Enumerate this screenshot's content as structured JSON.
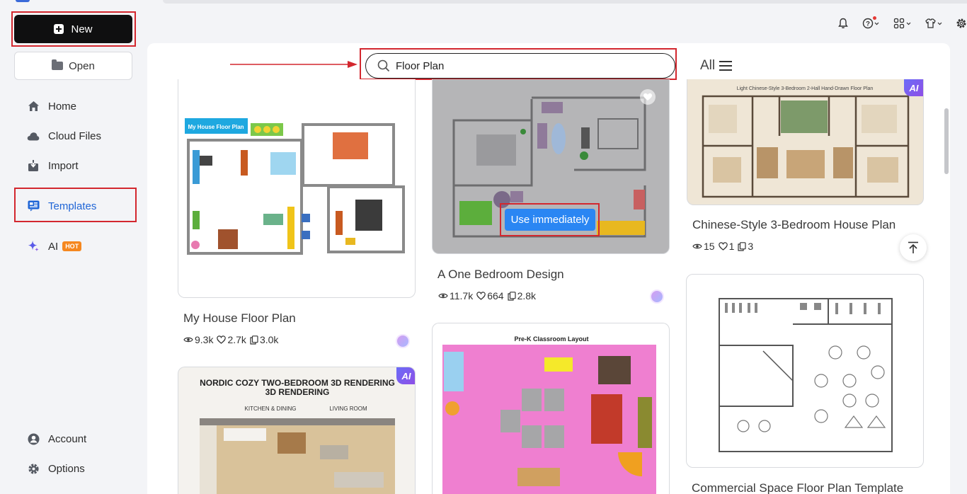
{
  "sidebar": {
    "new_label": "New",
    "open_label": "Open",
    "nav": [
      {
        "label": "Home",
        "icon": "home-icon"
      },
      {
        "label": "Cloud Files",
        "icon": "cloud-icon"
      },
      {
        "label": "Import",
        "icon": "import-icon"
      },
      {
        "label": "Templates",
        "icon": "templates-icon"
      },
      {
        "label": "AI",
        "icon": "ai-sparkle-icon",
        "badge": "HOT"
      }
    ],
    "bottom": [
      {
        "label": "Account",
        "icon": "account-icon"
      },
      {
        "label": "Options",
        "icon": "gear-icon"
      }
    ]
  },
  "header": {
    "icons": [
      "bell-icon",
      "help-icon",
      "apps-icon",
      "skin-icon",
      "settings-icon"
    ]
  },
  "search": {
    "value": "Floor Plan"
  },
  "filter": {
    "label": "All"
  },
  "cards": [
    {
      "title": "My House Floor Plan",
      "views": "9.3k",
      "likes": "2.7k",
      "copies": "3.0k",
      "thumb_label": "My House Floor Plan"
    },
    {
      "title": "A One Bedroom Design",
      "views": "11.7k",
      "likes": "664",
      "copies": "2.8k",
      "action": "Use immediately"
    },
    {
      "title": "Chinese-Style 3-Bedroom House Plan",
      "views": "15",
      "likes": "1",
      "copies": "3",
      "thumb_label": "Light Chinese-Style 3-Bedroom 2-Hall Hand-Drawn Floor Plan",
      "badge": "AI"
    },
    {
      "title": "",
      "thumb_title": "NORDIC COZY TWO-BEDROOM 3D RENDERING",
      "thumb_subtitle": "3D RENDERING",
      "thumb_left": "KITCHEN & DINING",
      "thumb_right": "LIVING ROOM",
      "badge": "AI"
    },
    {
      "title": "",
      "thumb_title": "Pre-K Classroom Layout"
    },
    {
      "title": "Commercial Space Floor Plan Template"
    }
  ],
  "colors": {
    "accent": "#2a86f3",
    "highlight_box": "#d3272e",
    "templates_active": "#1f65d6",
    "hot_badge": "#f5871f"
  }
}
